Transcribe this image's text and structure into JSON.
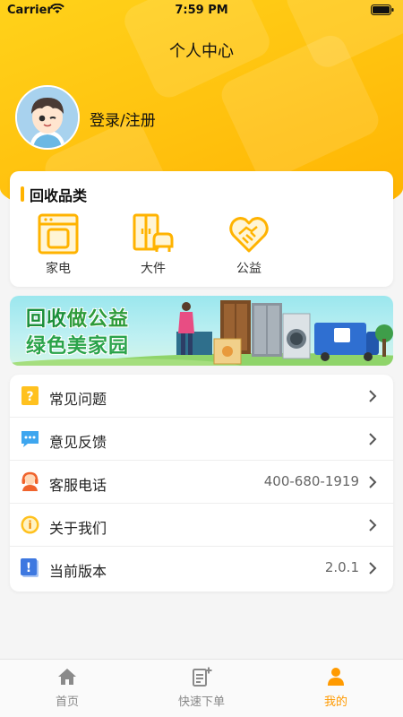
{
  "status_bar": {
    "carrier": "Carrier",
    "time": "7:59 PM"
  },
  "header": {
    "title": "个人中心",
    "login_label": "登录/注册"
  },
  "categories": {
    "title": "回收品类",
    "items": [
      {
        "label": "家电",
        "icon": "appliance-icon"
      },
      {
        "label": "大件",
        "icon": "furniture-icon"
      },
      {
        "label": "公益",
        "icon": "charity-heart-icon"
      }
    ]
  },
  "banner": {
    "line1_a": "回收",
    "line1_b": "做公益",
    "line2": "绿色美家园"
  },
  "menu": [
    {
      "label": "常见问题",
      "value": "",
      "icon": "faq-icon"
    },
    {
      "label": "意见反馈",
      "value": "",
      "icon": "feedback-icon"
    },
    {
      "label": "客服电话",
      "value": "400-680-1919",
      "icon": "customer-service-icon"
    },
    {
      "label": "关于我们",
      "value": "",
      "icon": "about-icon"
    },
    {
      "label": "当前版本",
      "value": "2.0.1",
      "icon": "version-icon"
    }
  ],
  "tabs": [
    {
      "label": "首页",
      "icon": "home-icon",
      "active": false
    },
    {
      "label": "快速下单",
      "icon": "quick-order-icon",
      "active": false
    },
    {
      "label": "我的",
      "icon": "profile-icon",
      "active": true
    }
  ],
  "colors": {
    "accent": "#ffc10e",
    "active_tab": "#ff9a00",
    "banner_green": "#2e9b3a"
  }
}
